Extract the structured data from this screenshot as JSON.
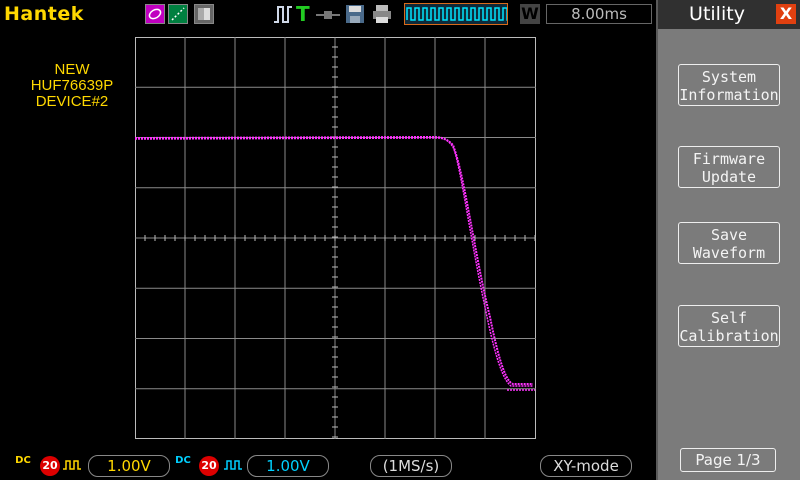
{
  "header": {
    "brand": "Hantek",
    "timebase": "8.00ms",
    "w_label": "W"
  },
  "menu": {
    "title": "Utility",
    "close": "X",
    "buttons": [
      {
        "label": "System\nInformation"
      },
      {
        "label": "Firmware\nUpdate"
      },
      {
        "label": "Save\nWaveform"
      },
      {
        "label": "Self\nCalibration"
      }
    ],
    "page": "Page 1/3"
  },
  "screen": {
    "annotation_line1": "NEW",
    "annotation_line2": "HUF76639P",
    "annotation_line3": "DEVICE#2"
  },
  "footer": {
    "ch1": {
      "coupling": "DC",
      "bw": "20",
      "volts": "1.00V"
    },
    "ch2": {
      "coupling": "DC",
      "bw": "20",
      "volts": "1.00V"
    },
    "sample_rate": "(1MS/s)",
    "mode": "XY-mode"
  },
  "colors": {
    "trace": "#ff33ff",
    "ch1": "#ffd800",
    "ch2": "#00d0ff",
    "menu_bg": "#7b7b7b",
    "brand": "#ffd800"
  }
}
